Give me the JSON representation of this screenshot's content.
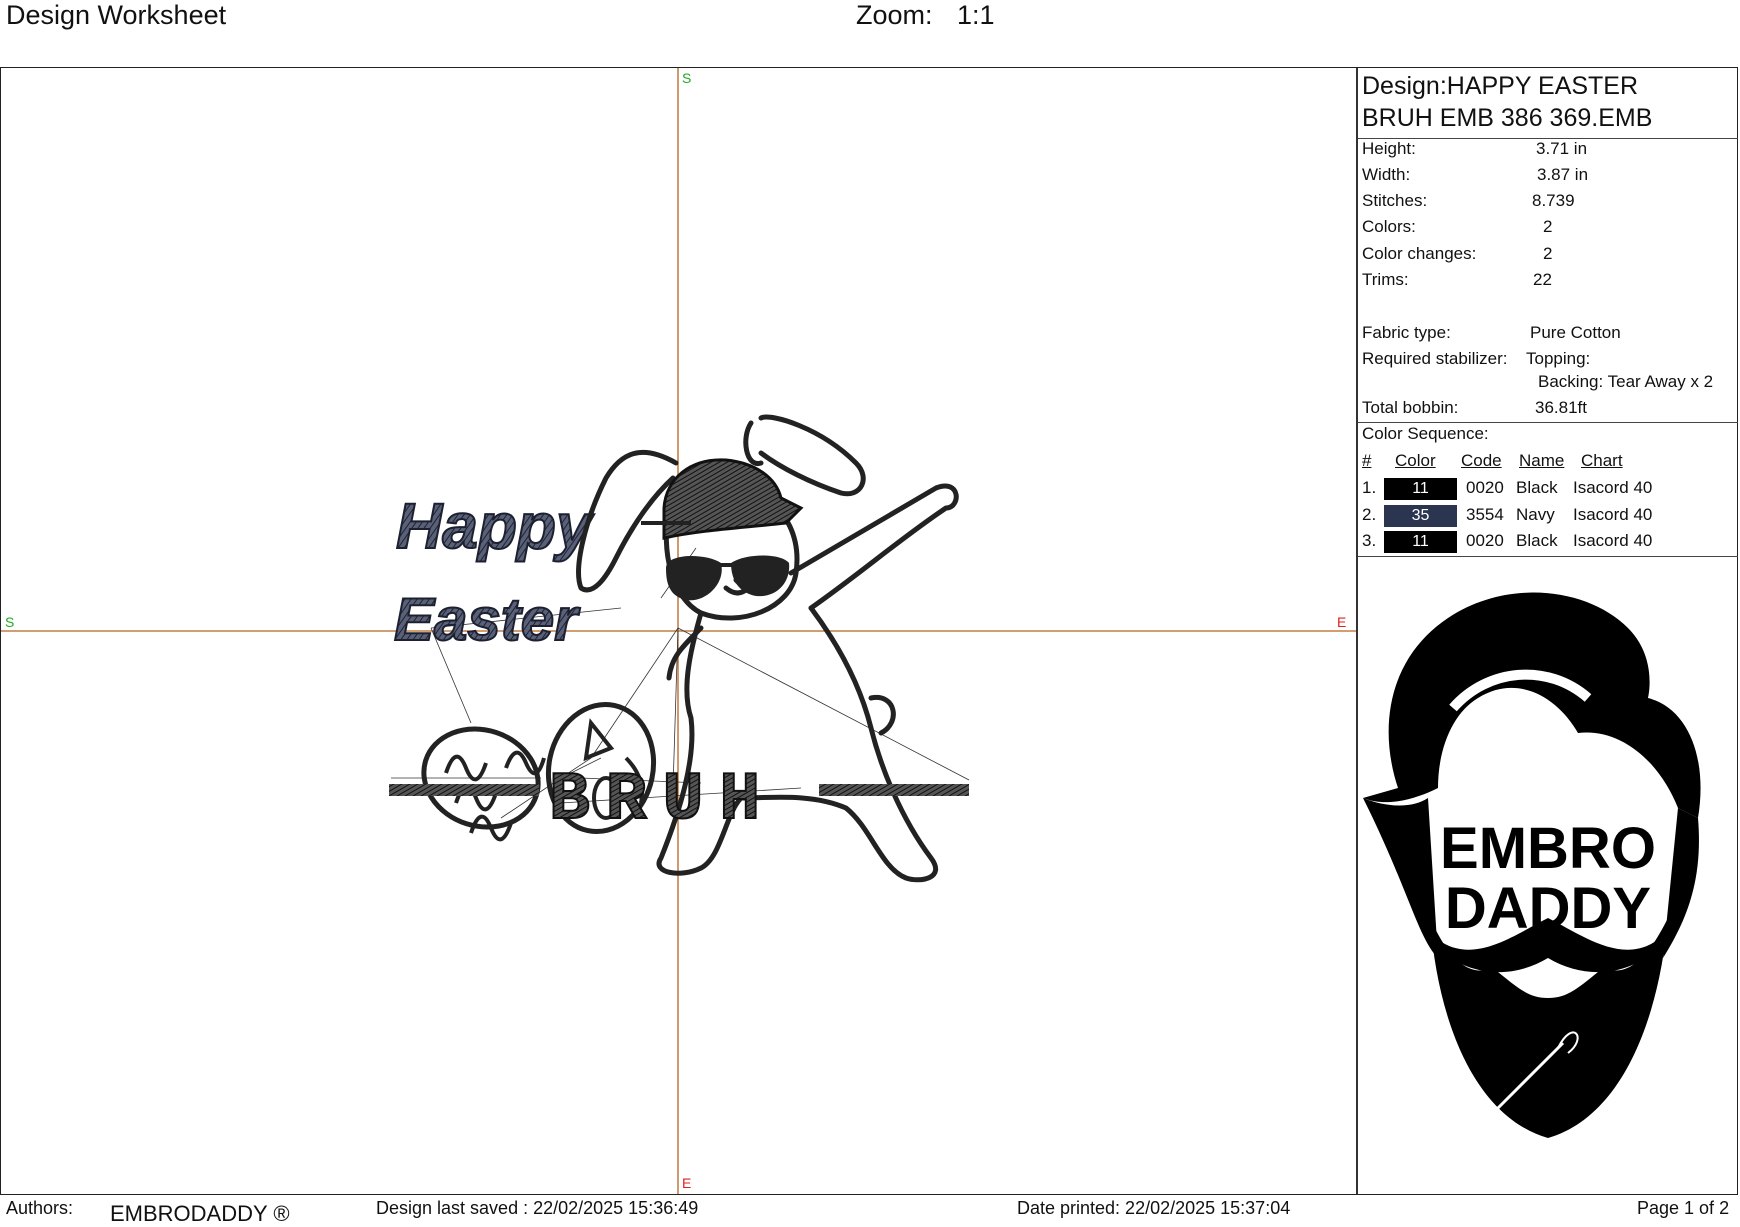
{
  "header": {
    "title": "Design Worksheet",
    "zoom_label": "Zoom:",
    "zoom_value": "1:1"
  },
  "canvas": {
    "axis_markers": {
      "top": "S",
      "left": "S",
      "right": "E",
      "bottom": "E"
    },
    "artwork_text": {
      "line1": "Happy",
      "line2": "Easter",
      "line3": "BRUH"
    },
    "colors": {
      "axis": "#b5651d",
      "start_marker": "#22aa22",
      "end_marker": "#dd2222",
      "thread_dark": "#1e1e1e",
      "thread_navy": "#2d3552"
    }
  },
  "panel": {
    "design_name_line1": "Design:HAPPY EASTER",
    "design_name_line2": "BRUH EMB 386 369.EMB",
    "info": {
      "height_label": "Height:",
      "height_value": "3.71 in",
      "width_label": "Width:",
      "width_value": "3.87 in",
      "stitches_label": "Stitches:",
      "stitches_value": "8.739",
      "colors_label": "Colors:",
      "colors_value": "2",
      "color_changes_label": "Color changes:",
      "color_changes_value": "2",
      "trims_label": "Trims:",
      "trims_value": "22",
      "fabric_label": "Fabric type:",
      "fabric_value": "Pure Cotton",
      "stabilizer_label": "Required stabilizer:",
      "topping_value": "Topping:",
      "backing_value": "Backing: Tear Away x 2",
      "bobbin_label": "Total bobbin:",
      "bobbin_value": "36.81ft"
    },
    "color_sequence": {
      "title": "Color Sequence:",
      "headers": {
        "num": "#",
        "color": "Color",
        "code": "Code",
        "name": "Name",
        "chart": "Chart"
      },
      "rows": [
        {
          "num": "1.",
          "swatch": "11",
          "swatch_color": "#000000",
          "code": "0020",
          "name": "Black",
          "chart": "Isacord 40"
        },
        {
          "num": "2.",
          "swatch": "35",
          "swatch_color": "#2b3550",
          "code": "3554",
          "name": "Navy",
          "chart": "Isacord 40"
        },
        {
          "num": "3.",
          "swatch": "11",
          "swatch_color": "#000000",
          "code": "0020",
          "name": "Black",
          "chart": "Isacord 40"
        }
      ]
    },
    "logo": {
      "line1": "EMBRO",
      "line2": "DADDY"
    }
  },
  "footer": {
    "authors_label": "Authors:",
    "authors_value": "EMBRODADDY ®",
    "saved": "Design last saved : 22/02/2025 15:36:49",
    "printed": "Date printed: 22/02/2025 15:37:04",
    "page": "Page 1 of 2"
  }
}
